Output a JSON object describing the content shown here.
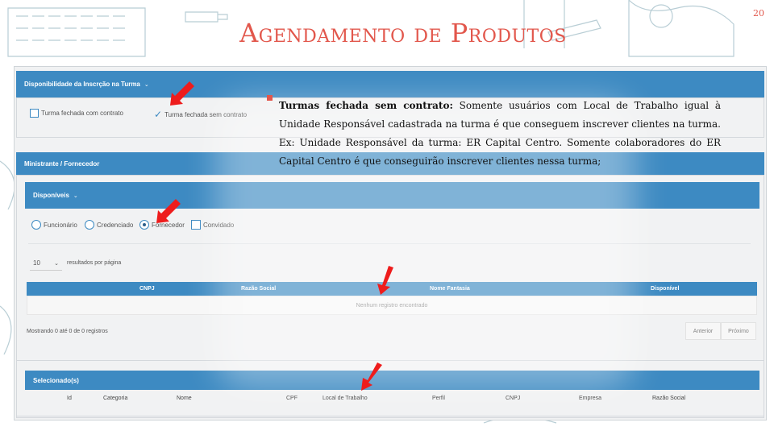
{
  "slide": {
    "title": "Agendamento de Produtos",
    "page_number": "20"
  },
  "availability_panel": {
    "header": "Disponibilidade da Inscrção na Turma",
    "option_closed_with_contract": "Turma fechada com contrato",
    "option_closed_without_contract": "Turma fechada sem contrato"
  },
  "minister_panel": {
    "header": "Ministrante / Fornecedor",
    "available_header": "Disponíveis",
    "radio_options": [
      "Funcionário",
      "Credenciado",
      "Fornecedor"
    ],
    "selected_radio": "Fornecedor",
    "checkbox_option": "Convidado",
    "page_size": "10",
    "page_size_label": "resultados por página",
    "columns": [
      "CNPJ",
      "Razão Social",
      "Nome Fantasia",
      "Disponível"
    ],
    "empty_message": "Nenhum registro encontrado",
    "info_text": "Mostrando 0 até 0 de 0 registros",
    "prev_label": "Anterior",
    "next_label": "Próximo"
  },
  "selected_panel": {
    "header": "Selecionado(s)",
    "columns": [
      "Id",
      "Categoria",
      "Nome",
      "CPF",
      "Local de Trabalho",
      "Perfil",
      "CNPJ",
      "Empresa",
      "Razão Social"
    ]
  },
  "note": {
    "bold_lead": "Turmas fechada sem contrato:",
    "body": " Somente usuários com Local de Trabalho igual à Unidade Responsável cadastrada na turma é que conseguem inscrever clientes na turma. Ex: Unidade Responsável da turma: ER Capital Centro. Somente colaboradores do ER Capital Centro é que conseguirão inscrever clientes nessa turma;"
  },
  "colors": {
    "accent": "#e2574c",
    "header_blue": "#3d8ac2",
    "arrow_red": "#ee1c1c"
  }
}
